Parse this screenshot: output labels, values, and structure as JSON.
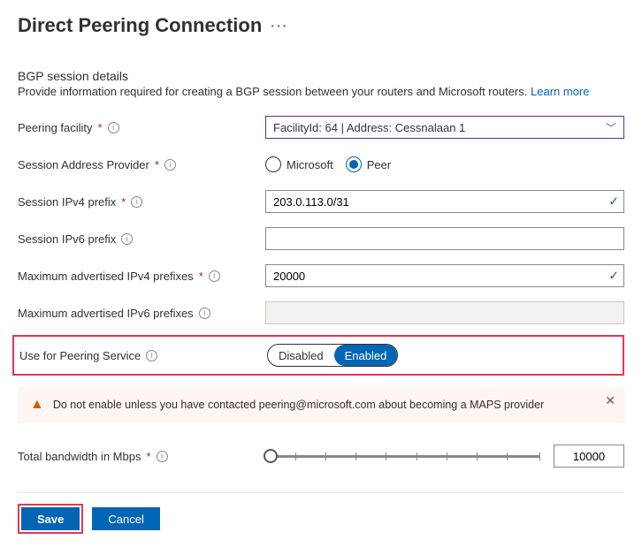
{
  "title": "Direct Peering Connection",
  "section": {
    "heading": "BGP session details",
    "description": "Provide information required for creating a BGP session between your routers and Microsoft routers.",
    "learn_more": "Learn more"
  },
  "fields": {
    "peering_facility": {
      "label": "Peering facility",
      "value": "FacilityId: 64 | Address: Cessnalaan 1"
    },
    "session_provider": {
      "label": "Session Address Provider",
      "option_ms": "Microsoft",
      "option_peer": "Peer"
    },
    "ipv4_prefix": {
      "label": "Session IPv4 prefix",
      "value": "203.0.113.0/31"
    },
    "ipv6_prefix": {
      "label": "Session IPv6 prefix",
      "value": ""
    },
    "max_ipv4": {
      "label": "Maximum advertised IPv4 prefixes",
      "value": "20000"
    },
    "max_ipv6": {
      "label": "Maximum advertised IPv6 prefixes",
      "value": ""
    },
    "peering_service": {
      "label": "Use for Peering Service",
      "disabled": "Disabled",
      "enabled": "Enabled"
    },
    "bandwidth": {
      "label": "Total bandwidth in Mbps",
      "value": "10000"
    }
  },
  "alert": "Do not enable unless you have contacted peering@microsoft.com about becoming a MAPS provider",
  "buttons": {
    "save": "Save",
    "cancel": "Cancel"
  }
}
